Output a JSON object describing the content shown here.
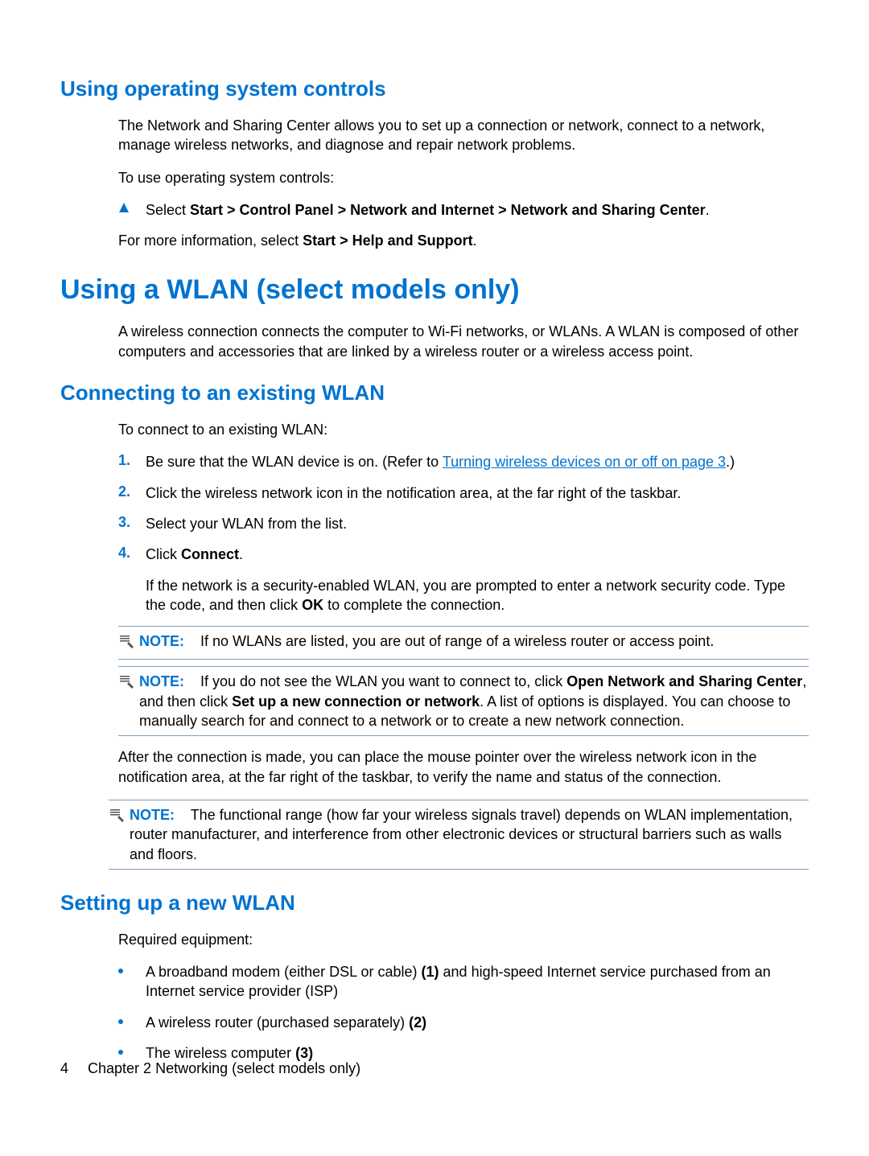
{
  "colors": {
    "accent": "#0073cf"
  },
  "s1": {
    "heading": "Using operating system controls",
    "p1": "The Network and Sharing Center allows you to set up a connection or network, connect to a network, manage wireless networks, and diagnose and repair network problems.",
    "p2": "To use operating system controls:",
    "step_prefix": "Select ",
    "step_bold": "Start > Control Panel > Network and Internet > Network and Sharing Center",
    "step_suffix": ".",
    "p3_prefix": "For more information, select ",
    "p3_bold": "Start > Help and Support",
    "p3_suffix": "."
  },
  "s2": {
    "heading": "Using a WLAN (select models only)",
    "p1": "A wireless connection connects the computer to Wi-Fi networks, or WLANs. A WLAN is composed of other computers and accessories that are linked by a wireless router or a wireless access point."
  },
  "s3": {
    "heading": "Connecting to an existing WLAN",
    "p1": "To connect to an existing WLAN:",
    "steps": {
      "n1": "1.",
      "t1_pre": "Be sure that the WLAN device is on. (Refer to ",
      "t1_link": "Turning wireless devices on or off on page 3",
      "t1_post": ".)",
      "n2": "2.",
      "t2": "Click the wireless network icon in the notification area, at the far right of the taskbar.",
      "n3": "3.",
      "t3": "Select your WLAN from the list.",
      "n4": "4.",
      "t4_pre": "Click ",
      "t4_bold": "Connect",
      "t4_post": ".",
      "t4_sub_pre": "If the network is a security-enabled WLAN, you are prompted to enter a network security code. Type the code, and then click ",
      "t4_sub_bold": "OK",
      "t4_sub_post": " to complete the connection."
    },
    "note1_label": "NOTE:",
    "note1_text": "If no WLANs are listed, you are out of range of a wireless router or access point.",
    "note2_label": "NOTE:",
    "note2_pre": "If you do not see the WLAN you want to connect to, click ",
    "note2_b1": "Open Network and Sharing Center",
    "note2_mid": ", and then click ",
    "note2_b2": "Set up a new connection or network",
    "note2_post": ". A list of options is displayed. You can choose to manually search for and connect to a network or to create a new network connection.",
    "p2": "After the connection is made, you can place the mouse pointer over the wireless network icon in the notification area, at the far right of the taskbar, to verify the name and status of the connection.",
    "note3_label": "NOTE:",
    "note3_text": "The functional range (how far your wireless signals travel) depends on WLAN implementation, router manufacturer, and interference from other electronic devices or structural barriers such as walls and floors."
  },
  "s4": {
    "heading": "Setting up a new WLAN",
    "p1": "Required equipment:",
    "bullets": {
      "b1_pre": "A broadband modem (either DSL or cable) ",
      "b1_bold": "(1)",
      "b1_post": " and high-speed Internet service purchased from an Internet service provider (ISP)",
      "b2_pre": "A wireless router (purchased separately) ",
      "b2_bold": "(2)",
      "b3_pre": "The wireless computer ",
      "b3_bold": "(3)"
    }
  },
  "footer": {
    "page": "4",
    "chapter": "Chapter 2   Networking (select models only)"
  }
}
